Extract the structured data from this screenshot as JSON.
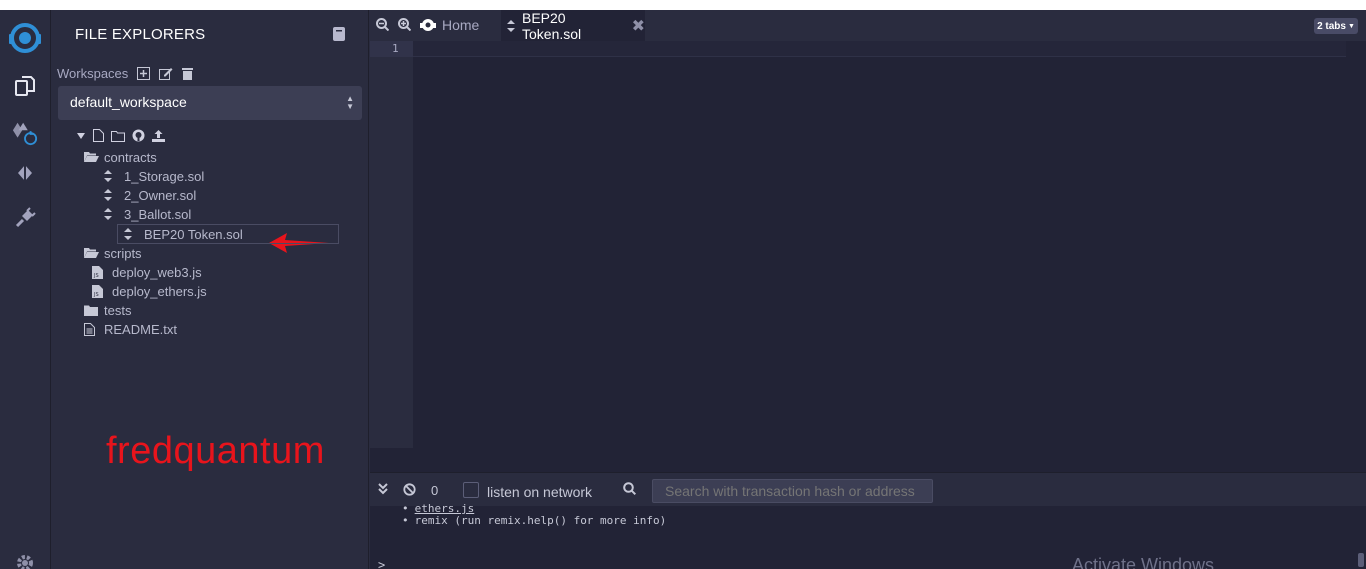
{
  "rail": {
    "items": [
      "remix-logo-icon",
      "file-explorers-icon",
      "solidity-compiler-icon",
      "deploy-run-icon",
      "plugin-manager-icon"
    ],
    "settings_icon": "gear-icon"
  },
  "explorer": {
    "title": "FILE EXPLORERS",
    "workspaces_label": "Workspaces",
    "workspace_selected": "default_workspace",
    "tree": [
      {
        "label": "contracts",
        "type": "folder-open"
      },
      {
        "label": "1_Storage.sol",
        "type": "solidity"
      },
      {
        "label": "2_Owner.sol",
        "type": "solidity"
      },
      {
        "label": "3_Ballot.sol",
        "type": "solidity"
      },
      {
        "label": "BEP20 Token.sol",
        "type": "solidity",
        "selected": true
      },
      {
        "label": "scripts",
        "type": "folder-open"
      },
      {
        "label": "deploy_web3.js",
        "type": "js"
      },
      {
        "label": "deploy_ethers.js",
        "type": "js"
      },
      {
        "label": "tests",
        "type": "folder"
      },
      {
        "label": "README.txt",
        "type": "file"
      }
    ]
  },
  "watermark": "fredquantum",
  "editor": {
    "home_tab": "Home",
    "active_tab": "BEP20 Token.sol",
    "tabs_count": "2 tabs",
    "line_number": "1"
  },
  "terminal": {
    "count": "0",
    "listen_label": "listen on network",
    "search_placeholder": "Search with transaction hash or address",
    "output_line_1": "ethers.js",
    "output_line_2": "remix (run remix.help() for more info)",
    "prompt": ">",
    "activate_text": "Activate Windows"
  },
  "colors": {
    "background": "#2a2c3f",
    "editor": "#222336",
    "watermark": "#e8141c",
    "arrow": "#e8141c"
  }
}
